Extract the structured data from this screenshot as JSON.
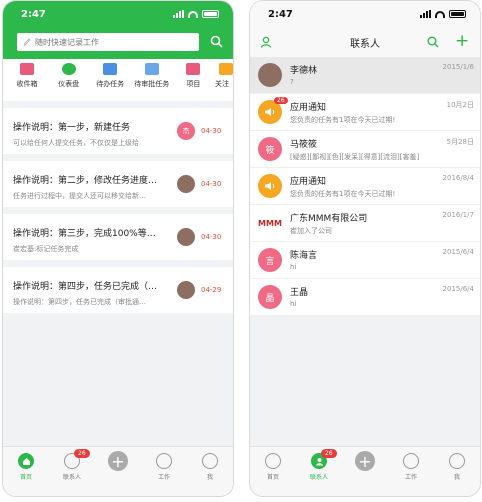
{
  "left": {
    "status": {
      "time": "2:47"
    },
    "search": {
      "placeholder": "随时快速记录工作"
    },
    "quick": [
      {
        "label": "收件箱",
        "icon": "inbox-icon",
        "color": "#e85b7a"
      },
      {
        "label": "仪表盘",
        "icon": "dashboard-icon",
        "color": "#2db84b"
      },
      {
        "label": "待办任务",
        "icon": "todo-icon",
        "color": "#4a90e2"
      },
      {
        "label": "待审批任务",
        "icon": "approval-icon",
        "color": "#6aa7e8"
      },
      {
        "label": "项目",
        "icon": "project-icon",
        "color": "#e85b7a"
      },
      {
        "label": "关注",
        "icon": "follow-icon",
        "color": "#f5a623"
      }
    ],
    "cards": [
      {
        "title": "操作说明：第一步，新建任务",
        "desc": "可以给任何人提交任务，不仅仅是上级给",
        "avatar": "杰",
        "date": "04-30"
      },
      {
        "title": "操作说明：第二步，修改任务进度…",
        "desc": "任务进行过程中，提交人还可以移交给新…",
        "avatar": "",
        "date": "04-30"
      },
      {
        "title": "操作说明：第三步，完成100%等…",
        "desc": "崔宏基:标记任务完成",
        "avatar": "",
        "date": "04-30"
      },
      {
        "title": "操作说明：第四步，任务已完成（…",
        "desc": "操作说明：第四步，任务已完成（审批通…",
        "avatar": "",
        "date": "04-29"
      }
    ],
    "tabs": [
      {
        "label": "首页",
        "badge": ""
      },
      {
        "label": "联系人",
        "badge": "26"
      },
      {
        "label": "",
        "badge": ""
      },
      {
        "label": "工作",
        "badge": ""
      },
      {
        "label": "我",
        "badge": ""
      }
    ]
  },
  "right": {
    "status": {
      "time": "2:47"
    },
    "title": "联系人",
    "contacts": [
      {
        "name": "李德林",
        "msg": "?",
        "date": "2015/1/6",
        "avatar": "",
        "color": "#8d6e63",
        "badge": ""
      },
      {
        "name": "应用通知",
        "msg": "您负责的任务有1项在今天已过期!",
        "date": "10月2日",
        "avatar": "",
        "color": "#f5a623",
        "badge": "26"
      },
      {
        "name": "马筱筱",
        "msg": "[疑惑][鄙视][色][发呆][得意][流泪][害羞]",
        "date": "5月28日",
        "avatar": "筱",
        "color": "#ef6a84",
        "badge": ""
      },
      {
        "name": "应用通知",
        "msg": "您负责的任务有1项在今天已过期!",
        "date": "2016/8/4",
        "avatar": "",
        "color": "#f5a623",
        "badge": ""
      },
      {
        "name": "广东MMM有限公司",
        "msg": "崔加入了公司",
        "date": "2016/1/7",
        "avatar": "MMM",
        "color": "#ffffff",
        "badge": ""
      },
      {
        "name": "陈海言",
        "msg": "hi",
        "date": "2015/6/4",
        "avatar": "言",
        "color": "#ef6a84",
        "badge": ""
      },
      {
        "name": "王晶",
        "msg": "hi",
        "date": "2015/6/4",
        "avatar": "晶",
        "color": "#ef6a84",
        "badge": ""
      }
    ],
    "tabs": [
      {
        "label": "首页",
        "badge": ""
      },
      {
        "label": "联系人",
        "badge": "26"
      },
      {
        "label": "",
        "badge": ""
      },
      {
        "label": "工作",
        "badge": ""
      },
      {
        "label": "我",
        "badge": ""
      }
    ]
  }
}
